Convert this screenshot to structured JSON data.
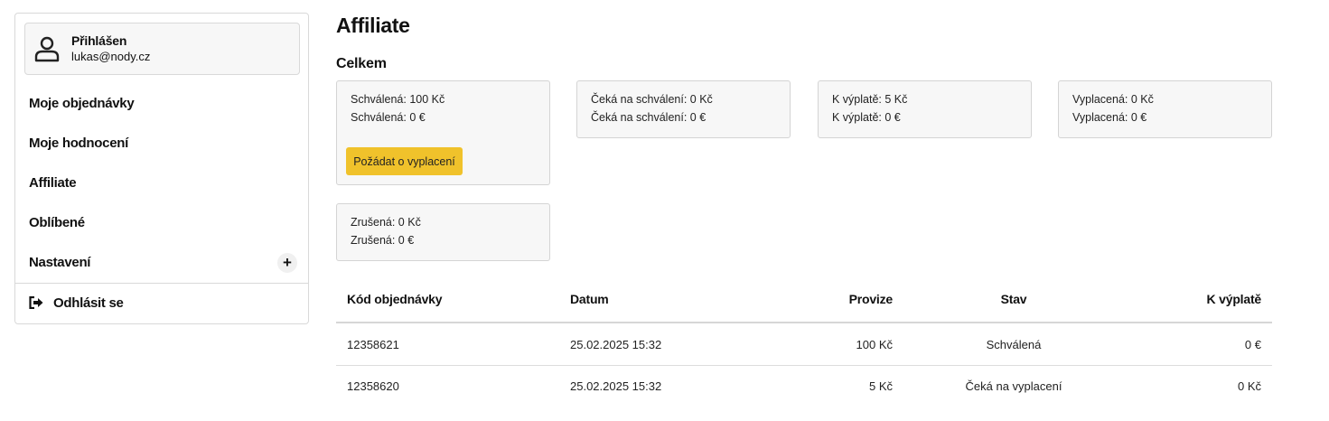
{
  "user": {
    "status": "Přihlášen",
    "email": "lukas@nody.cz"
  },
  "sidebar": {
    "items": [
      {
        "label": "Moje objednávky"
      },
      {
        "label": "Moje hodnocení"
      },
      {
        "label": "Affiliate"
      },
      {
        "label": "Oblíbené"
      },
      {
        "label": "Nastavení"
      }
    ],
    "expand_symbol": "+",
    "logout_label": "Odhlásit se"
  },
  "main": {
    "title": "Affiliate",
    "section_title": "Celkem",
    "cards": {
      "approved": {
        "line1": "Schválená: 100 Kč",
        "line2": "Schválená: 0 €",
        "button": "Požádat o vyplacení"
      },
      "pending": {
        "line1": "Čeká na schválení: 0 Kč",
        "line2": "Čeká na schválení: 0 €"
      },
      "to_pay": {
        "line1": "K výplatě: 5 Kč",
        "line2": "K výplatě: 0 €"
      },
      "paid": {
        "line1": "Vyplacená: 0 Kč",
        "line2": "Vyplacená: 0 €"
      },
      "cancelled": {
        "line1": "Zrušená: 0 Kč",
        "line2": "Zrušená: 0 €"
      }
    },
    "accent_color": "#f0c22b"
  },
  "table": {
    "headers": {
      "order": "Kód objednávky",
      "date": "Datum",
      "commission": "Provize",
      "status": "Stav",
      "payout": "K výplatě"
    },
    "rows": [
      {
        "order": "12358621",
        "date": "25.02.2025 15:32",
        "commission": "100 Kč",
        "status": "Schválená",
        "payout": "0 €"
      },
      {
        "order": "12358620",
        "date": "25.02.2025 15:32",
        "commission": "5 Kč",
        "status": "Čeká na vyplacení",
        "payout": "0 Kč"
      }
    ]
  }
}
